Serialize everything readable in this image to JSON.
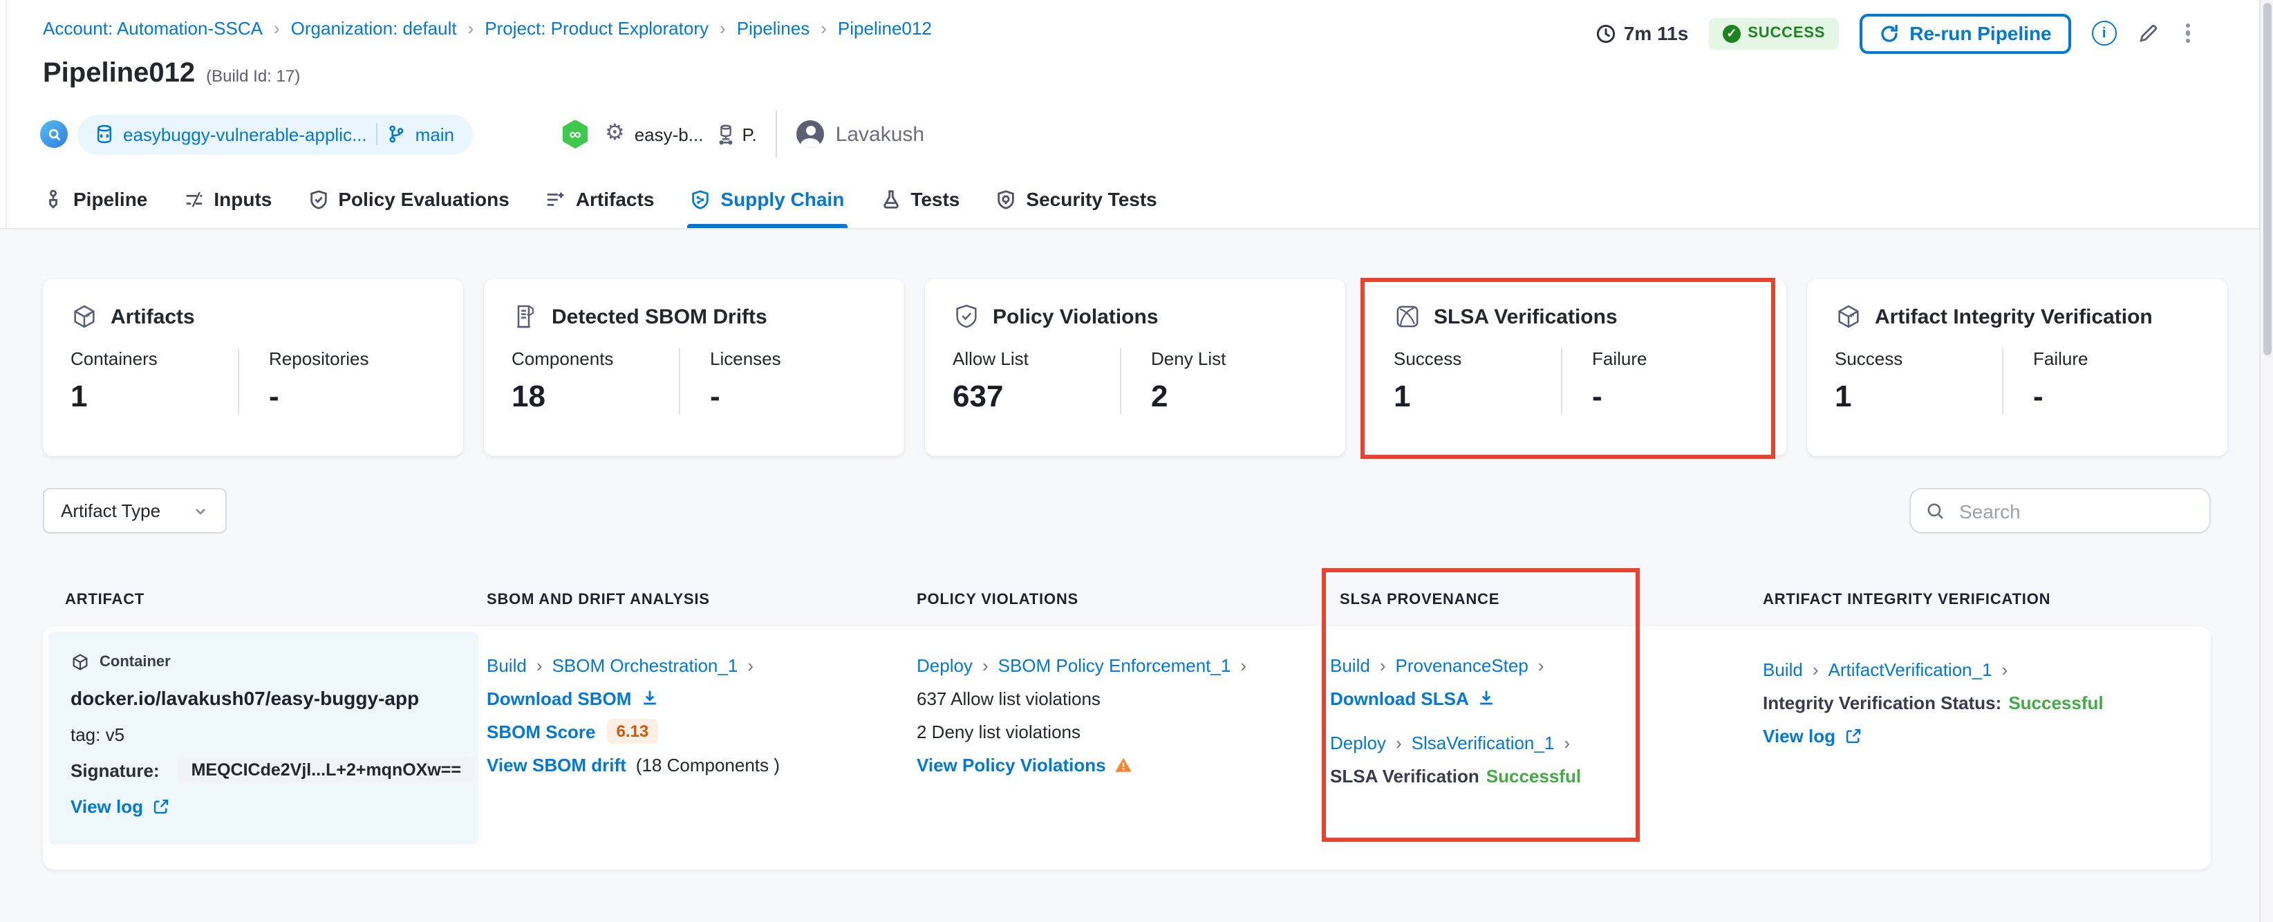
{
  "breadcrumb": {
    "items": [
      "Account: Automation-SSCA",
      "Organization: default",
      "Project: Product Exploratory",
      "Pipelines",
      "Pipeline012"
    ]
  },
  "run_meta": {
    "duration": "7m 11s",
    "status": "SUCCESS",
    "rerun_label": "Re-run Pipeline"
  },
  "title": {
    "name": "Pipeline012",
    "build_id": "(Build Id: 17)"
  },
  "context": {
    "repo": "easybuggy-vulnerable-applic...",
    "branch": "main",
    "service": "easy-b...",
    "environment": "P.",
    "user": "Lavakush",
    "link_symbol": "∞"
  },
  "tabs": {
    "items": [
      {
        "label": "Pipeline"
      },
      {
        "label": "Inputs"
      },
      {
        "label": "Policy Evaluations"
      },
      {
        "label": "Artifacts"
      },
      {
        "label": "Supply Chain"
      },
      {
        "label": "Tests"
      },
      {
        "label": "Security Tests"
      }
    ],
    "active": "Supply Chain"
  },
  "cards": [
    {
      "title": "Artifacts",
      "stats": [
        {
          "label": "Containers",
          "value": "1"
        },
        {
          "label": "Repositories",
          "value": "-"
        }
      ]
    },
    {
      "title": "Detected SBOM Drifts",
      "stats": [
        {
          "label": "Components",
          "value": "18"
        },
        {
          "label": "Licenses",
          "value": "-"
        }
      ]
    },
    {
      "title": "Policy Violations",
      "stats": [
        {
          "label": "Allow List",
          "value": "637"
        },
        {
          "label": "Deny List",
          "value": "2"
        }
      ]
    },
    {
      "title": "SLSA Verifications",
      "highlighted": true,
      "stats": [
        {
          "label": "Success",
          "value": "1"
        },
        {
          "label": "Failure",
          "value": "-"
        }
      ]
    },
    {
      "title": "Artifact Integrity Verification",
      "stats": [
        {
          "label": "Success",
          "value": "1"
        },
        {
          "label": "Failure",
          "value": "-"
        }
      ]
    }
  ],
  "filters": {
    "artifact_type_label": "Artifact Type",
    "search_placeholder": "Search"
  },
  "table": {
    "headers": [
      "ARTIFACT",
      "SBOM AND DRIFT ANALYSIS",
      "POLICY VIOLATIONS",
      "SLSA PROVENANCE",
      "ARTIFACT INTEGRITY VERIFICATION"
    ],
    "row": {
      "artifact": {
        "type_label": "Container",
        "image": "docker.io/lavakush07/easy-buggy-app",
        "tag": "tag: v5",
        "signature_label": "Signature:",
        "signature_value": "MEQCICde2Vjl...L+2+mqnOXw==",
        "view_log": "View log"
      },
      "sbom": {
        "stage": "Build",
        "step": "SBOM Orchestration_1",
        "download": "Download SBOM",
        "score_label": "SBOM Score",
        "score": "6.13",
        "drift_link": "View SBOM drift",
        "drift_suffix": "(18 Components )"
      },
      "policy": {
        "stage": "Deploy",
        "step": "SBOM Policy Enforcement_1",
        "allow": "637 Allow list violations",
        "deny": "2 Deny list violations",
        "view": "View Policy Violations"
      },
      "slsa": {
        "stage1": "Build",
        "step1": "ProvenanceStep",
        "download": "Download SLSA",
        "stage2": "Deploy",
        "step2": "SlsaVerification_1",
        "status_label": "SLSA Verification",
        "status_value": "Successful"
      },
      "integrity": {
        "stage": "Build",
        "step": "ArtifactVerification_1",
        "status_label": "Integrity Verification Status:",
        "status_value": "Successful",
        "view_log": "View log"
      }
    }
  },
  "colors": {
    "accent_blue": "#0278d5",
    "success_badge_bg": "#e3f7e4",
    "success_badge_text": "#1b841f",
    "status_green": "#42ab45",
    "annotation_red": "#e8432f",
    "warning_orange": "#ff832b",
    "score_text": "#cb5a0c",
    "score_bg": "#fdefe3",
    "artifact_cell_bg": "#edf7fc"
  }
}
